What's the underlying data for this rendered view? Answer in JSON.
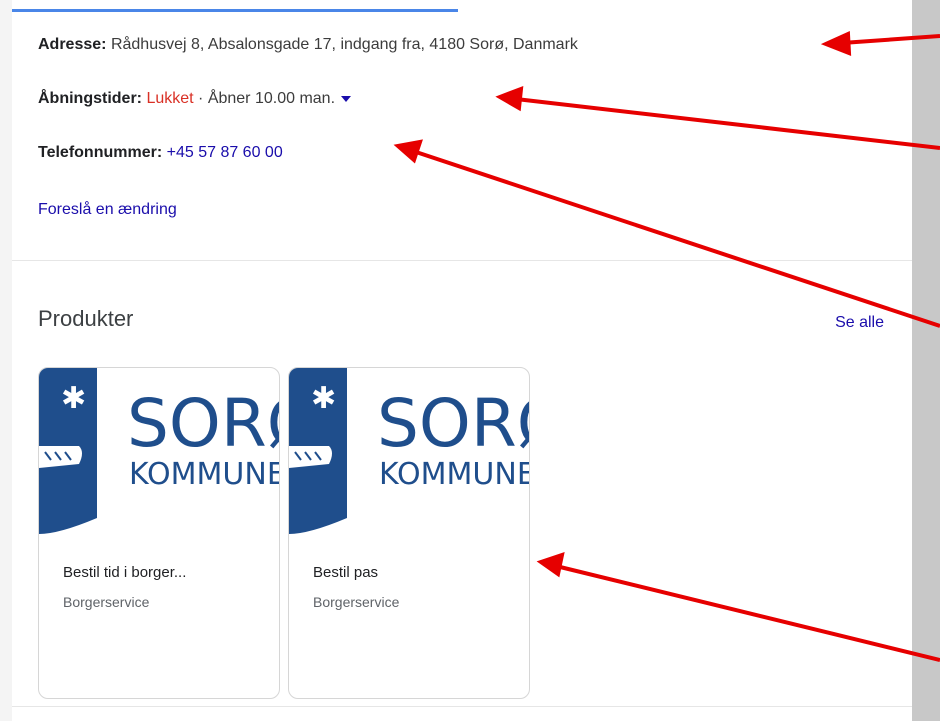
{
  "info": {
    "address_label": "Adresse:",
    "address_value": "Rådhusvej 8, Absalonsgade 17, indgang fra, 4180 Sorø, Danmark",
    "hours_label": "Åbningstider:",
    "hours_status": "Lukket",
    "hours_sep": " · ",
    "hours_next": "Åbner 10.00 man.",
    "phone_label": "Telefonnummer:",
    "phone_value": "+45 57 87 60 00",
    "suggest_edit": "Foreslå en ændring"
  },
  "products": {
    "title": "Produkter",
    "see_all": "Se alle",
    "items": [
      {
        "logo_line1": "SORØ",
        "logo_line2": "KOMMUNE",
        "name": "Bestil tid i borger...",
        "category": "Borgerservice"
      },
      {
        "logo_line1": "SORØ",
        "logo_line2": "KOMMUNE",
        "name": "Bestil pas",
        "category": "Borgerservice"
      }
    ]
  },
  "colors": {
    "closed": "#d93025",
    "link": "#1a0dab",
    "logo_blue": "#1f4e8c",
    "annotation_arrow": "#e60000"
  }
}
